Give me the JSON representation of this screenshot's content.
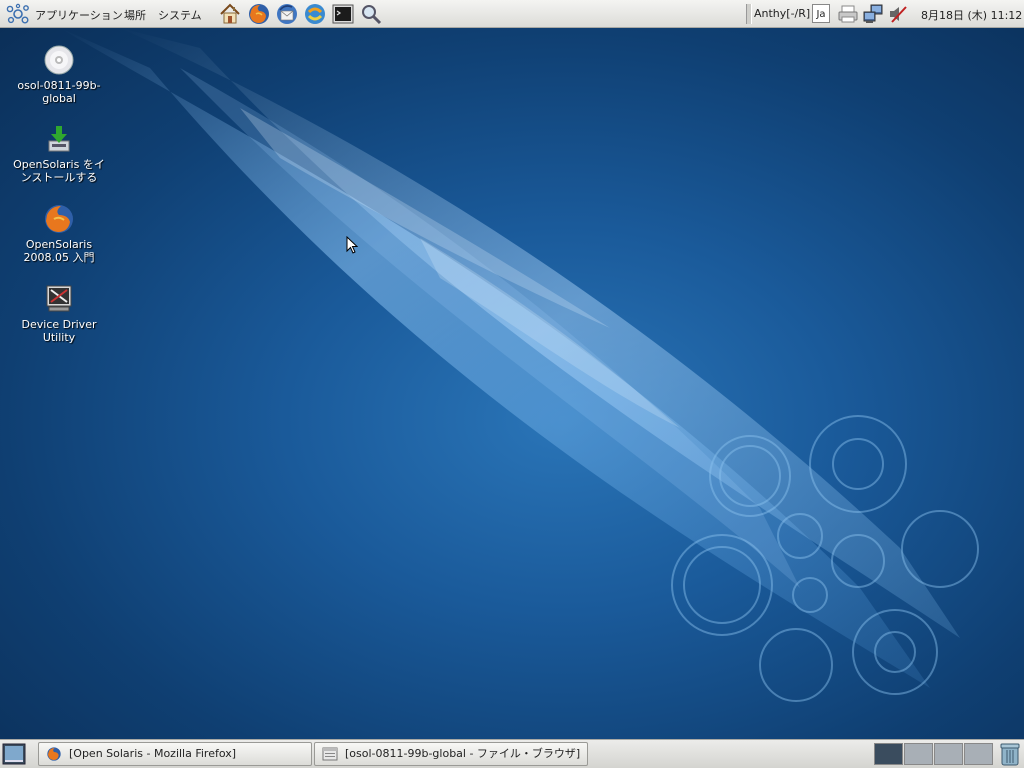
{
  "top_panel": {
    "menus": [
      "アプリケーション",
      "場所",
      "システム"
    ],
    "launchers": [
      "home-icon",
      "firefox-icon",
      "thunderbird-icon",
      "update-manager-icon",
      "terminal-icon",
      "search-icon"
    ],
    "input_method": "Anthy[-/R]",
    "language": "Ja",
    "tray_icons": [
      "printer-icon",
      "network-icon",
      "volume-muted-icon"
    ],
    "clock": "8月18日 (木) 11:12"
  },
  "desktop": {
    "icons": [
      {
        "line1": "osol-0811-99b-",
        "line2": "global",
        "icon": "cdrom-icon"
      },
      {
        "line1": "OpenSolaris をイ",
        "line2": "ンストールする",
        "icon": "install-icon"
      },
      {
        "line1": "OpenSolaris",
        "line2": "2008.05 入門",
        "icon": "firefox-icon"
      },
      {
        "line1": "Device Driver",
        "line2": "Utility",
        "icon": "driver-utility-icon"
      }
    ]
  },
  "bottom_panel": {
    "tasks": [
      {
        "label": "[Open Solaris - Mozilla Firefox]",
        "icon": "firefox-icon"
      },
      {
        "label": "[osol-0811-99b-global - ファイル・ブラウザ]",
        "icon": "file-browser-icon"
      }
    ],
    "workspaces": 4,
    "active_workspace": 1
  },
  "colors": {
    "desktop_bg": "#1a5a9a",
    "panel_bg": "#e4e4e0",
    "active_workspace": "#3a4c5e"
  }
}
